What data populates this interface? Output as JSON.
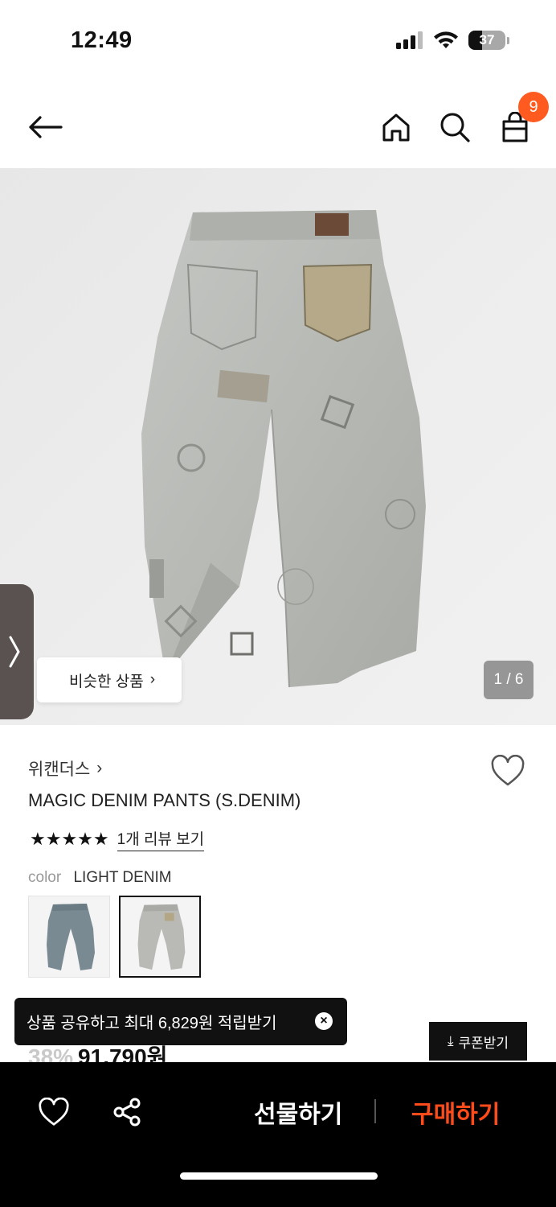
{
  "status_bar": {
    "time": "12:49",
    "battery": "37"
  },
  "nav": {
    "cart_count": "9"
  },
  "hero": {
    "page_indicator": "1 / 6",
    "similar_label": "비슷한 상품",
    "similar_chevron": "›"
  },
  "product": {
    "brand": "위캔더스",
    "brand_chevron": "›",
    "name": "MAGIC DENIM PANTS (S.DENIM)",
    "stars": "★★★★★",
    "review_link": "1개 리뷰 보기",
    "color_label": "color",
    "color_value": "LIGHT DENIM",
    "discount": "38%",
    "price": "91,790원"
  },
  "toast": {
    "text": "상품 공유하고 최대 6,829원 적립받기",
    "close": "×"
  },
  "coupon": {
    "label": "쿠폰받기",
    "icon": "⤓"
  },
  "bottom_bar": {
    "gift_label": "선물하기",
    "buy_label": "구매하기"
  },
  "icons": [
    "back-arrow-icon",
    "home-icon",
    "search-icon",
    "shopping-bag-icon",
    "heart-icon",
    "share-icon",
    "chevron-right-icon",
    "close-icon",
    "download-icon"
  ]
}
